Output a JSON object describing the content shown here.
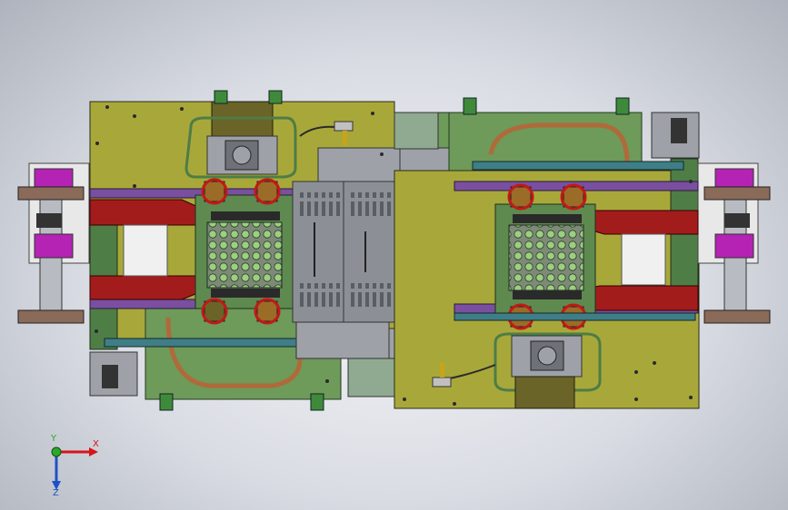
{
  "view": {
    "background_top": "#f4f5f8",
    "background_bottom": "#aeb3bd"
  },
  "model": {
    "colors": {
      "yellow_plate": "#a8a83a",
      "green_plate": "#6e9a5a",
      "green_dark": "#4e7d46",
      "grey_plate": "#9ea2a8",
      "grey_dark": "#6e7278",
      "red_rail": "#a31c1c",
      "purple_bar": "#7a4fa0",
      "teal_bar": "#3f7e86",
      "brown_block": "#9a6c28",
      "magenta_block": "#b423b4",
      "copper_pipe": "#b06a3a",
      "olive_block": "#6a6428",
      "white_plate": "#e8e8e8"
    }
  },
  "triad": {
    "x_label": "X",
    "y_label": "Y",
    "z_label": "Z",
    "x_color": "#d8141a",
    "y_color": "#2aa82a",
    "z_color": "#2050c8"
  }
}
